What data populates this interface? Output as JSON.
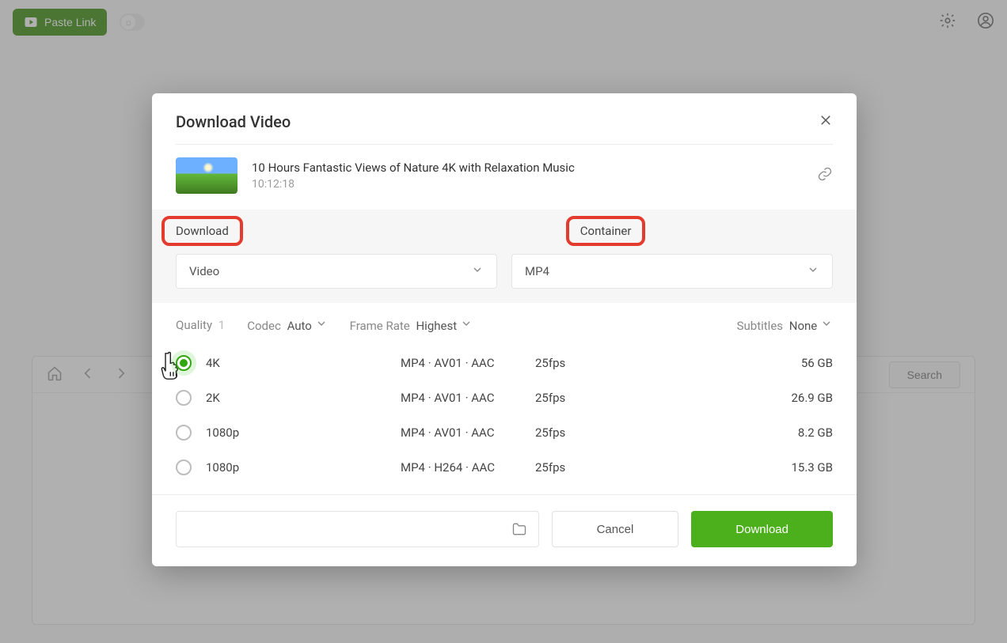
{
  "shell": {
    "paste_label": "Paste Link",
    "search_label": "Search"
  },
  "modal": {
    "title": "Download Video",
    "video": {
      "title": "10 Hours Fantastic Views of Nature 4K with Relaxation Music",
      "duration": "10:12:18"
    },
    "section_labels": {
      "download": "Download",
      "container": "Container"
    },
    "download_type": "Video",
    "container_type": "MP4",
    "filters": {
      "quality_label": "Quality",
      "quality_selected": "1",
      "codec_label": "Codec",
      "codec_value": "Auto",
      "frame_label": "Frame Rate",
      "frame_value": "Highest",
      "subs_label": "Subtitles",
      "subs_value": "None"
    },
    "options": [
      {
        "q": "4K",
        "codec": "MP4 · AV01 · AAC",
        "fps": "25fps",
        "size": "56 GB",
        "selected": true
      },
      {
        "q": "2K",
        "codec": "MP4 · AV01 · AAC",
        "fps": "25fps",
        "size": "26.9 GB",
        "selected": false
      },
      {
        "q": "1080p",
        "codec": "MP4 · AV01 · AAC",
        "fps": "25fps",
        "size": "8.2 GB",
        "selected": false
      },
      {
        "q": "1080p",
        "codec": "MP4 · H264 · AAC",
        "fps": "25fps",
        "size": "15.3 GB",
        "selected": false
      }
    ],
    "cancel_label": "Cancel",
    "download_label": "Download"
  },
  "highlights": [
    "download-section-label",
    "container-section-label"
  ]
}
